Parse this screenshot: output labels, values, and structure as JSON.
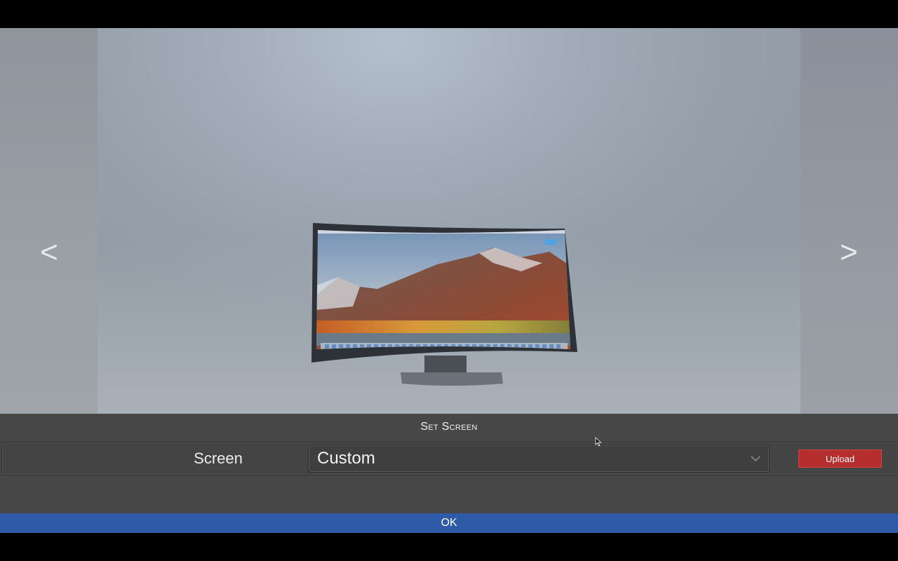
{
  "viewer": {
    "prev_label": "<",
    "next_label": ">"
  },
  "panel": {
    "title": "Set Screen",
    "screen_label": "Screen",
    "screen_select": {
      "value": "Custom",
      "icon": "chevron-down-icon"
    },
    "upload_label": "Upload"
  },
  "ok_label": "OK",
  "colors": {
    "panel_bg": "#474747",
    "upload_bg": "#b52d2d",
    "ok_bg": "#2e5aa8"
  }
}
